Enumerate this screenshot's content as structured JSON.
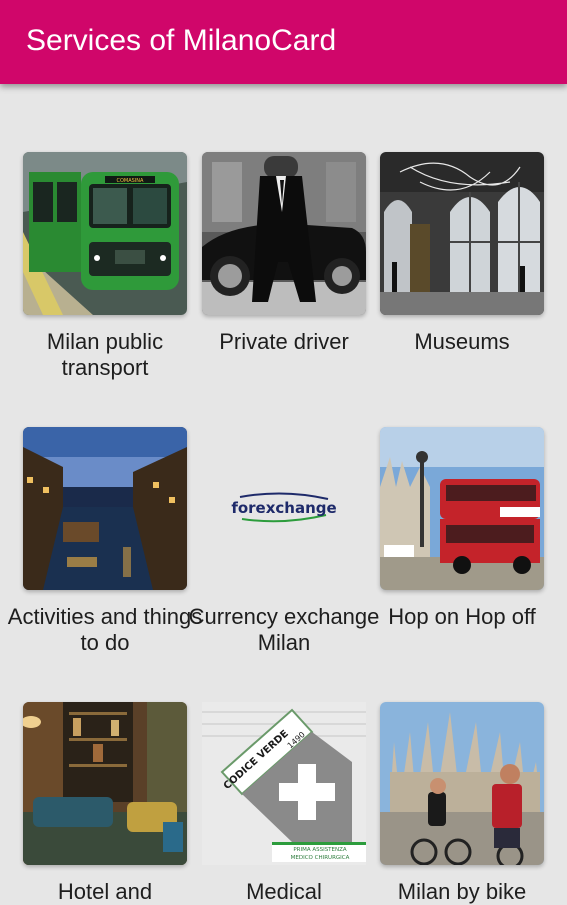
{
  "app": {
    "title": "Services of MilanoCard"
  },
  "colors": {
    "appbar": "#d0066a",
    "background": "#e6e6e6"
  },
  "services": [
    {
      "label": "Milan public transport",
      "icon": "metro-train-photo"
    },
    {
      "label": "Private driver",
      "icon": "chauffeur-car-photo"
    },
    {
      "label": "Museums",
      "icon": "museum-hall-photo"
    },
    {
      "label": "Activities and things to do",
      "icon": "navigli-canal-photo"
    },
    {
      "label": "Currency exchange Milan",
      "icon": "forexchange-logo",
      "logo_text": "forexchange"
    },
    {
      "label": "Hop on Hop off",
      "icon": "tour-bus-photo"
    },
    {
      "label": "Hotel and",
      "icon": "hotel-lobby-photo"
    },
    {
      "label": "Medical",
      "icon": "codice-verde-logo",
      "logo_text_1": "CODICE VERDE",
      "logo_text_2": "1490",
      "logo_text_3": "PRIMA ASSISTENZA",
      "logo_text_4": "MEDICO CHIRURGICA"
    },
    {
      "label": "Milan by bike",
      "icon": "duomo-bike-photo"
    }
  ]
}
